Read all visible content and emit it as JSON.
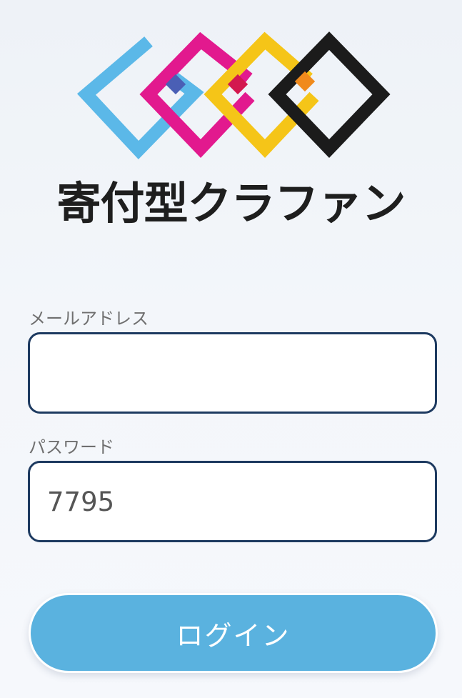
{
  "brand": {
    "title": "寄付型クラファン",
    "logo_icon": "interlocked-diamonds-logo",
    "logo_colors": [
      "#5bb8e8",
      "#e2198e",
      "#f5c518",
      "#1b1b1b"
    ]
  },
  "form": {
    "email": {
      "label": "メールアドレス",
      "value": ""
    },
    "password": {
      "label": "パスワード",
      "value": "7795"
    },
    "login_label": "ログイン"
  },
  "colors": {
    "accent": "#5ab2df",
    "input_border": "#1d3a60",
    "label_text": "#6f6f6f",
    "title_text": "#1e1e1e"
  }
}
